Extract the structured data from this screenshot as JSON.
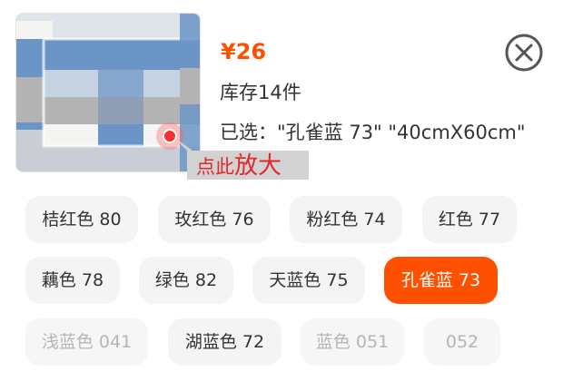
{
  "product": {
    "price": "¥26",
    "stock": "库存14件",
    "selected": "已选：\"孔雀蓝 73\" \"40cmX60cm\"",
    "zoom_hint_small": "点此",
    "zoom_hint_big": "放大",
    "image_colors": {
      "blue": "#6b95c6",
      "gray": "#b3b3b3",
      "white": "#f4f4f2"
    }
  },
  "close_icon": "close-circle-icon",
  "colors": {
    "accent": "#ff5000",
    "hint_red": "#e4262a"
  },
  "options": [
    {
      "label": "桔红色 80",
      "state": "normal"
    },
    {
      "label": "玫红色 76",
      "state": "normal"
    },
    {
      "label": "粉红色 74",
      "state": "normal"
    },
    {
      "label": "红色 77",
      "state": "normal"
    },
    {
      "label": "藕色 78",
      "state": "normal"
    },
    {
      "label": "绿色 82",
      "state": "normal"
    },
    {
      "label": "天蓝色 75",
      "state": "normal"
    },
    {
      "label": "孔雀蓝 73",
      "state": "selected"
    },
    {
      "label": "浅蓝色 041",
      "state": "disabled"
    },
    {
      "label": "湖蓝色 72",
      "state": "normal"
    },
    {
      "label": "蓝色 051",
      "state": "disabled"
    },
    {
      "label": "052",
      "state": "disabled"
    }
  ]
}
